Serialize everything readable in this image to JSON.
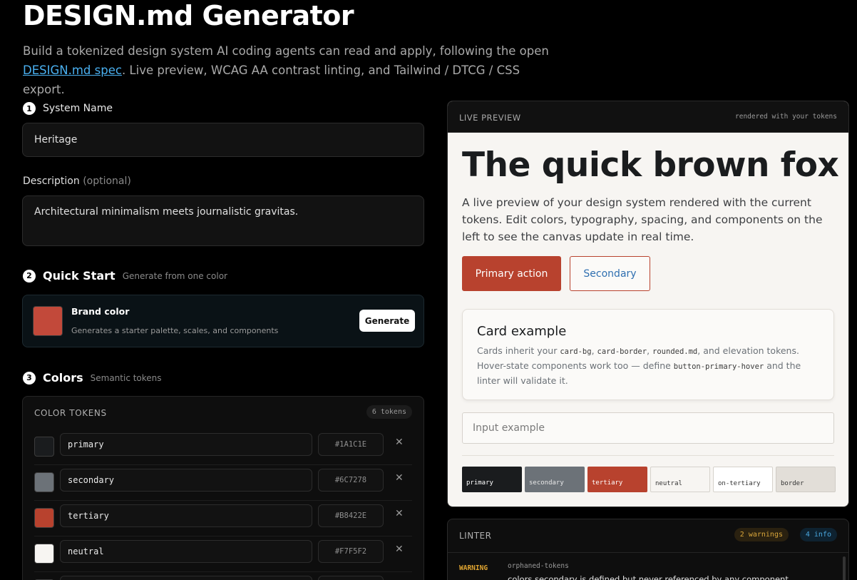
{
  "header": {
    "title": "DESIGN.md Generator",
    "subtitle_before": "Build a tokenized design system AI coding agents can read and apply, following the open ",
    "subtitle_link": "DESIGN.md spec",
    "subtitle_after": ". Live preview, WCAG AA contrast linting, and Tailwind / DTCG / CSS export."
  },
  "step1": {
    "num": "1",
    "label": "System Name",
    "value": "Heritage"
  },
  "description": {
    "label": "Description",
    "optional": "(optional)",
    "value": "Architectural minimalism meets journalistic gravitas."
  },
  "step2": {
    "num": "2",
    "label": "Quick Start",
    "hint": "Generate from one color",
    "brand_title": "Brand color",
    "brand_desc": "Generates a starter palette, scales, and components",
    "brand_color": "#c2493a",
    "button": "Generate"
  },
  "step3": {
    "num": "3",
    "label": "Colors",
    "hint": "Semantic tokens"
  },
  "tokens": {
    "heading": "COLOR TOKENS",
    "count": "6 tokens",
    "remove": "✕",
    "rows": [
      {
        "name": "primary",
        "hex": "#1A1C1E",
        "color": "#1a1c1e"
      },
      {
        "name": "secondary",
        "hex": "#6C7278",
        "color": "#6c7278"
      },
      {
        "name": "tertiary",
        "hex": "#B8422E",
        "color": "#b8422e"
      },
      {
        "name": "neutral",
        "hex": "#F7F5F2",
        "color": "#f7f5f2"
      },
      {
        "name": "",
        "hex": "",
        "color": "#ffffff"
      }
    ]
  },
  "preview": {
    "label": "LIVE PREVIEW",
    "note": "rendered with your tokens",
    "hero": "The quick brown fox",
    "paragraph": "A live preview of your design system rendered with the current tokens. Edit colors, typography, spacing, and components on the left to see the canvas update in real time.",
    "primary_btn": "Primary action",
    "secondary_btn": "Secondary",
    "card_title": "Card example",
    "card_t1": "Cards inherit your ",
    "card_c1": "card-bg",
    "card_t2": ", ",
    "card_c2": "card-border",
    "card_t3": ", ",
    "card_c3": "rounded.md",
    "card_t4": ", and elevation tokens. Hover-state components work too — define ",
    "card_c4": "button-primary-hover",
    "card_t5": " and the linter will validate it.",
    "input_placeholder": "Input example",
    "chips": [
      {
        "label": "primary",
        "bg": "#1a1c1e",
        "fg": "#ffffff"
      },
      {
        "label": "secondary",
        "bg": "#6c7278",
        "fg": "#e8e8e8"
      },
      {
        "label": "tertiary",
        "bg": "#b8422e",
        "fg": "#ffffff"
      },
      {
        "label": "neutral",
        "bg": "#f7f5f2",
        "fg": "#333333"
      },
      {
        "label": "on-tertiary",
        "bg": "#ffffff",
        "fg": "#333333"
      },
      {
        "label": "border",
        "bg": "#e2ded8",
        "fg": "#333333"
      }
    ]
  },
  "linter": {
    "label": "LINTER",
    "warnings": "2 warnings",
    "info": "4 info",
    "tag": "WARNING",
    "code": "orphaned-tokens",
    "message": "colors.secondary is defined but never referenced by any component."
  }
}
